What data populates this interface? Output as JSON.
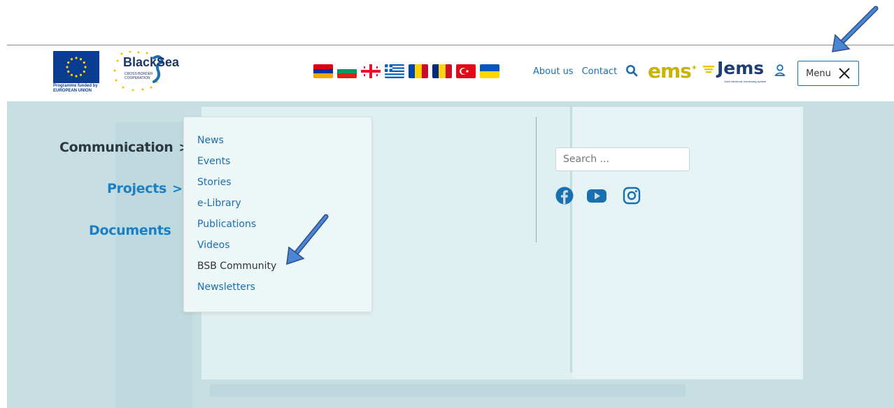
{
  "header": {
    "eu_caption_line1": "Programme funded by",
    "eu_caption_line2": "EUROPEAN UNION",
    "bs_word": "BlackSea",
    "bs_sub_line1": "CROSS BORDER",
    "bs_sub_line2": "COOPERATION",
    "nav": {
      "about": "About us",
      "contact": "Contact"
    },
    "ems_label": "ems",
    "jems_label": "Jems",
    "jems_sub": "Joint electronic monitoring system",
    "menu_label": "Menu"
  },
  "main_nav": {
    "items": [
      {
        "label": "Communication",
        "color": "#2d3740"
      },
      {
        "label": "Projects",
        "color": "#1a7fc4"
      },
      {
        "label": "Documents",
        "color": "#1a7fc4"
      }
    ]
  },
  "submenu": {
    "items": [
      {
        "label": "News"
      },
      {
        "label": "Events"
      },
      {
        "label": "Stories"
      },
      {
        "label": "e-Library"
      },
      {
        "label": "Publications"
      },
      {
        "label": "Videos"
      },
      {
        "label": "BSB Community"
      },
      {
        "label": "Newsletters"
      }
    ]
  },
  "search": {
    "placeholder": "Search ..."
  },
  "social": [
    "facebook-icon",
    "youtube-icon",
    "instagram-icon"
  ],
  "colors": {
    "accent": "#1a6fb0",
    "overlay": "#c7dfe3",
    "arrow": "#3b74c4"
  }
}
